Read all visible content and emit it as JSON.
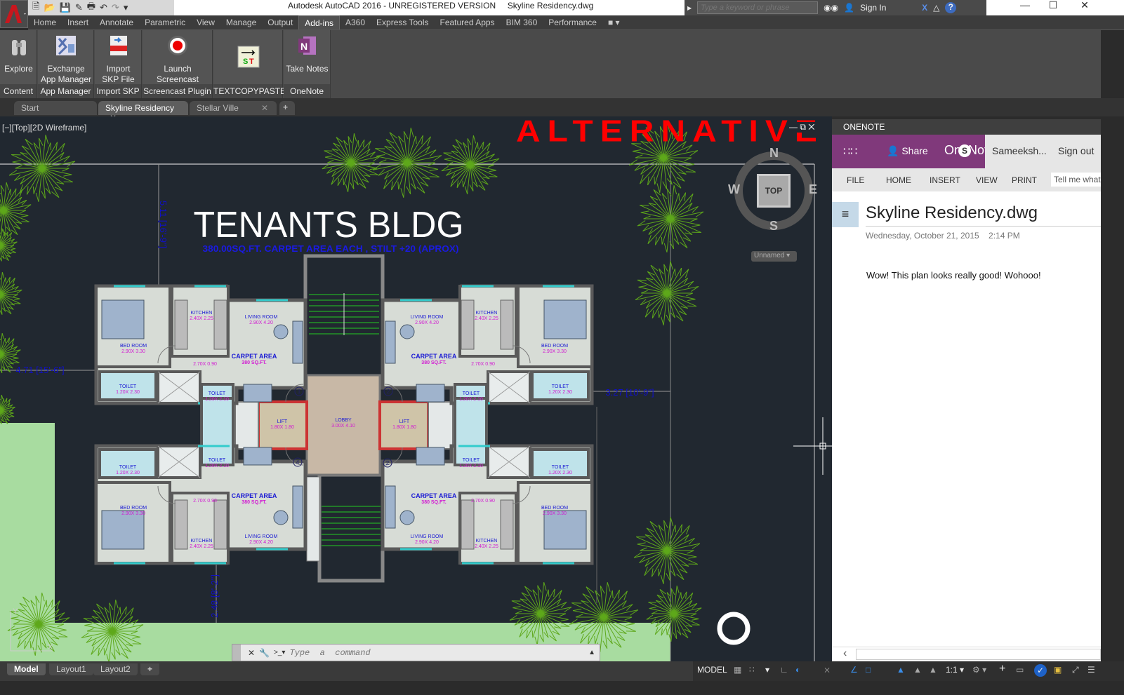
{
  "titlebar": {
    "title": "Autodesk AutoCAD 2016 - UNREGISTERED VERSION",
    "file": "Skyline Residency.dwg",
    "search_placeholder": "Type a keyword or phrase",
    "sign_in": "Sign In"
  },
  "menu_tabs": [
    "Home",
    "Insert",
    "Annotate",
    "Parametric",
    "View",
    "Manage",
    "Output",
    "Add-ins",
    "A360",
    "Express Tools",
    "Featured Apps",
    "BIM 360",
    "Performance"
  ],
  "active_menu_tab": "Add-ins",
  "ribbon": {
    "buttons": [
      {
        "label1": "Explore",
        "label2": "",
        "panel": "Content"
      },
      {
        "label1": "Exchange",
        "label2": "App Manager",
        "panel": "App Manager"
      },
      {
        "label1": "Import",
        "label2": "SKP File",
        "panel": "Import SKP"
      },
      {
        "label1": "Launch",
        "label2": "Screencast",
        "panel": "Screencast Plugin"
      },
      {
        "label1": "",
        "label2": "",
        "panel": "TEXTCOPYPASTE"
      },
      {
        "label1": "Take Notes",
        "label2": "",
        "panel": "OneNote"
      }
    ]
  },
  "file_tabs": [
    {
      "label": "Start"
    },
    {
      "label": "Skyline Residency"
    },
    {
      "label": "Stellar Ville"
    }
  ],
  "viewport": {
    "label": "[−][Top][2D Wireframe]",
    "banner": "ALTERNATIVE",
    "compass": {
      "n": "N",
      "s": "S",
      "e": "E",
      "w": "W",
      "top": "TOP"
    },
    "ucs_dropdown": "Unnamed",
    "command_placeholder": "Type  a  command"
  },
  "drawing": {
    "title": "TENANTS BLDG",
    "subtitle": "380.00SQ.FT. CARPET AREA EACH ,  STILT +20 (APROX)",
    "dimensions": [
      "5.11 [16'-9\"]",
      "4.71 [15'-6\"]",
      "3.27 [10'-9\"]",
      "2.48 [8'-2\"]"
    ],
    "rooms": [
      {
        "name": "KITCHEN",
        "size": "2.40X 2.25"
      },
      {
        "name": "LIVING ROOM",
        "size": "2.90X 4.20"
      },
      {
        "name": "BED ROOM",
        "size": "2.90X 3.30"
      },
      {
        "name": "",
        "size": "2.70X 0.90"
      },
      {
        "name": "CARPET AREA",
        "size": "380 SQ.FT."
      },
      {
        "name": "TOILET",
        "size": "1.20X 2.30"
      },
      {
        "name": "TOILET",
        "size": "1.20X 2.10"
      }
    ],
    "core": [
      {
        "name": "LOBBY",
        "size": "3.00X 4.10"
      },
      {
        "name": "LIFT",
        "size": "1.80X 1.80"
      }
    ],
    "flat_numbers": [
      "1",
      "2",
      "4",
      "2"
    ],
    "colors": {
      "walls": "#5a5a5a",
      "floor": "#d7dcd6",
      "toilet": "#bfe3ea",
      "trees": "#5ea81a",
      "label": "#1b1bd4",
      "size": "#d21ad2",
      "dimension": "#1010c8"
    }
  },
  "onenote": {
    "panel_title": "ONENOTE",
    "share": "Share",
    "brand": "OneNote",
    "user": "Sameeksh...",
    "sign_out": "Sign out",
    "menu": [
      "FILE",
      "HOME",
      "INSERT",
      "VIEW",
      "PRINT"
    ],
    "tell_me": "Tell me what",
    "page_title": "Skyline Residency.dwg",
    "date": "Wednesday, October 21, 2015",
    "time": "2:14 PM",
    "body": "Wow! This plan looks really good! Wohooo!",
    "accent": "#80397b"
  },
  "layout_tabs": [
    "Model",
    "Layout1",
    "Layout2"
  ],
  "statusbar": {
    "model": "MODEL",
    "scale": "1:1"
  }
}
